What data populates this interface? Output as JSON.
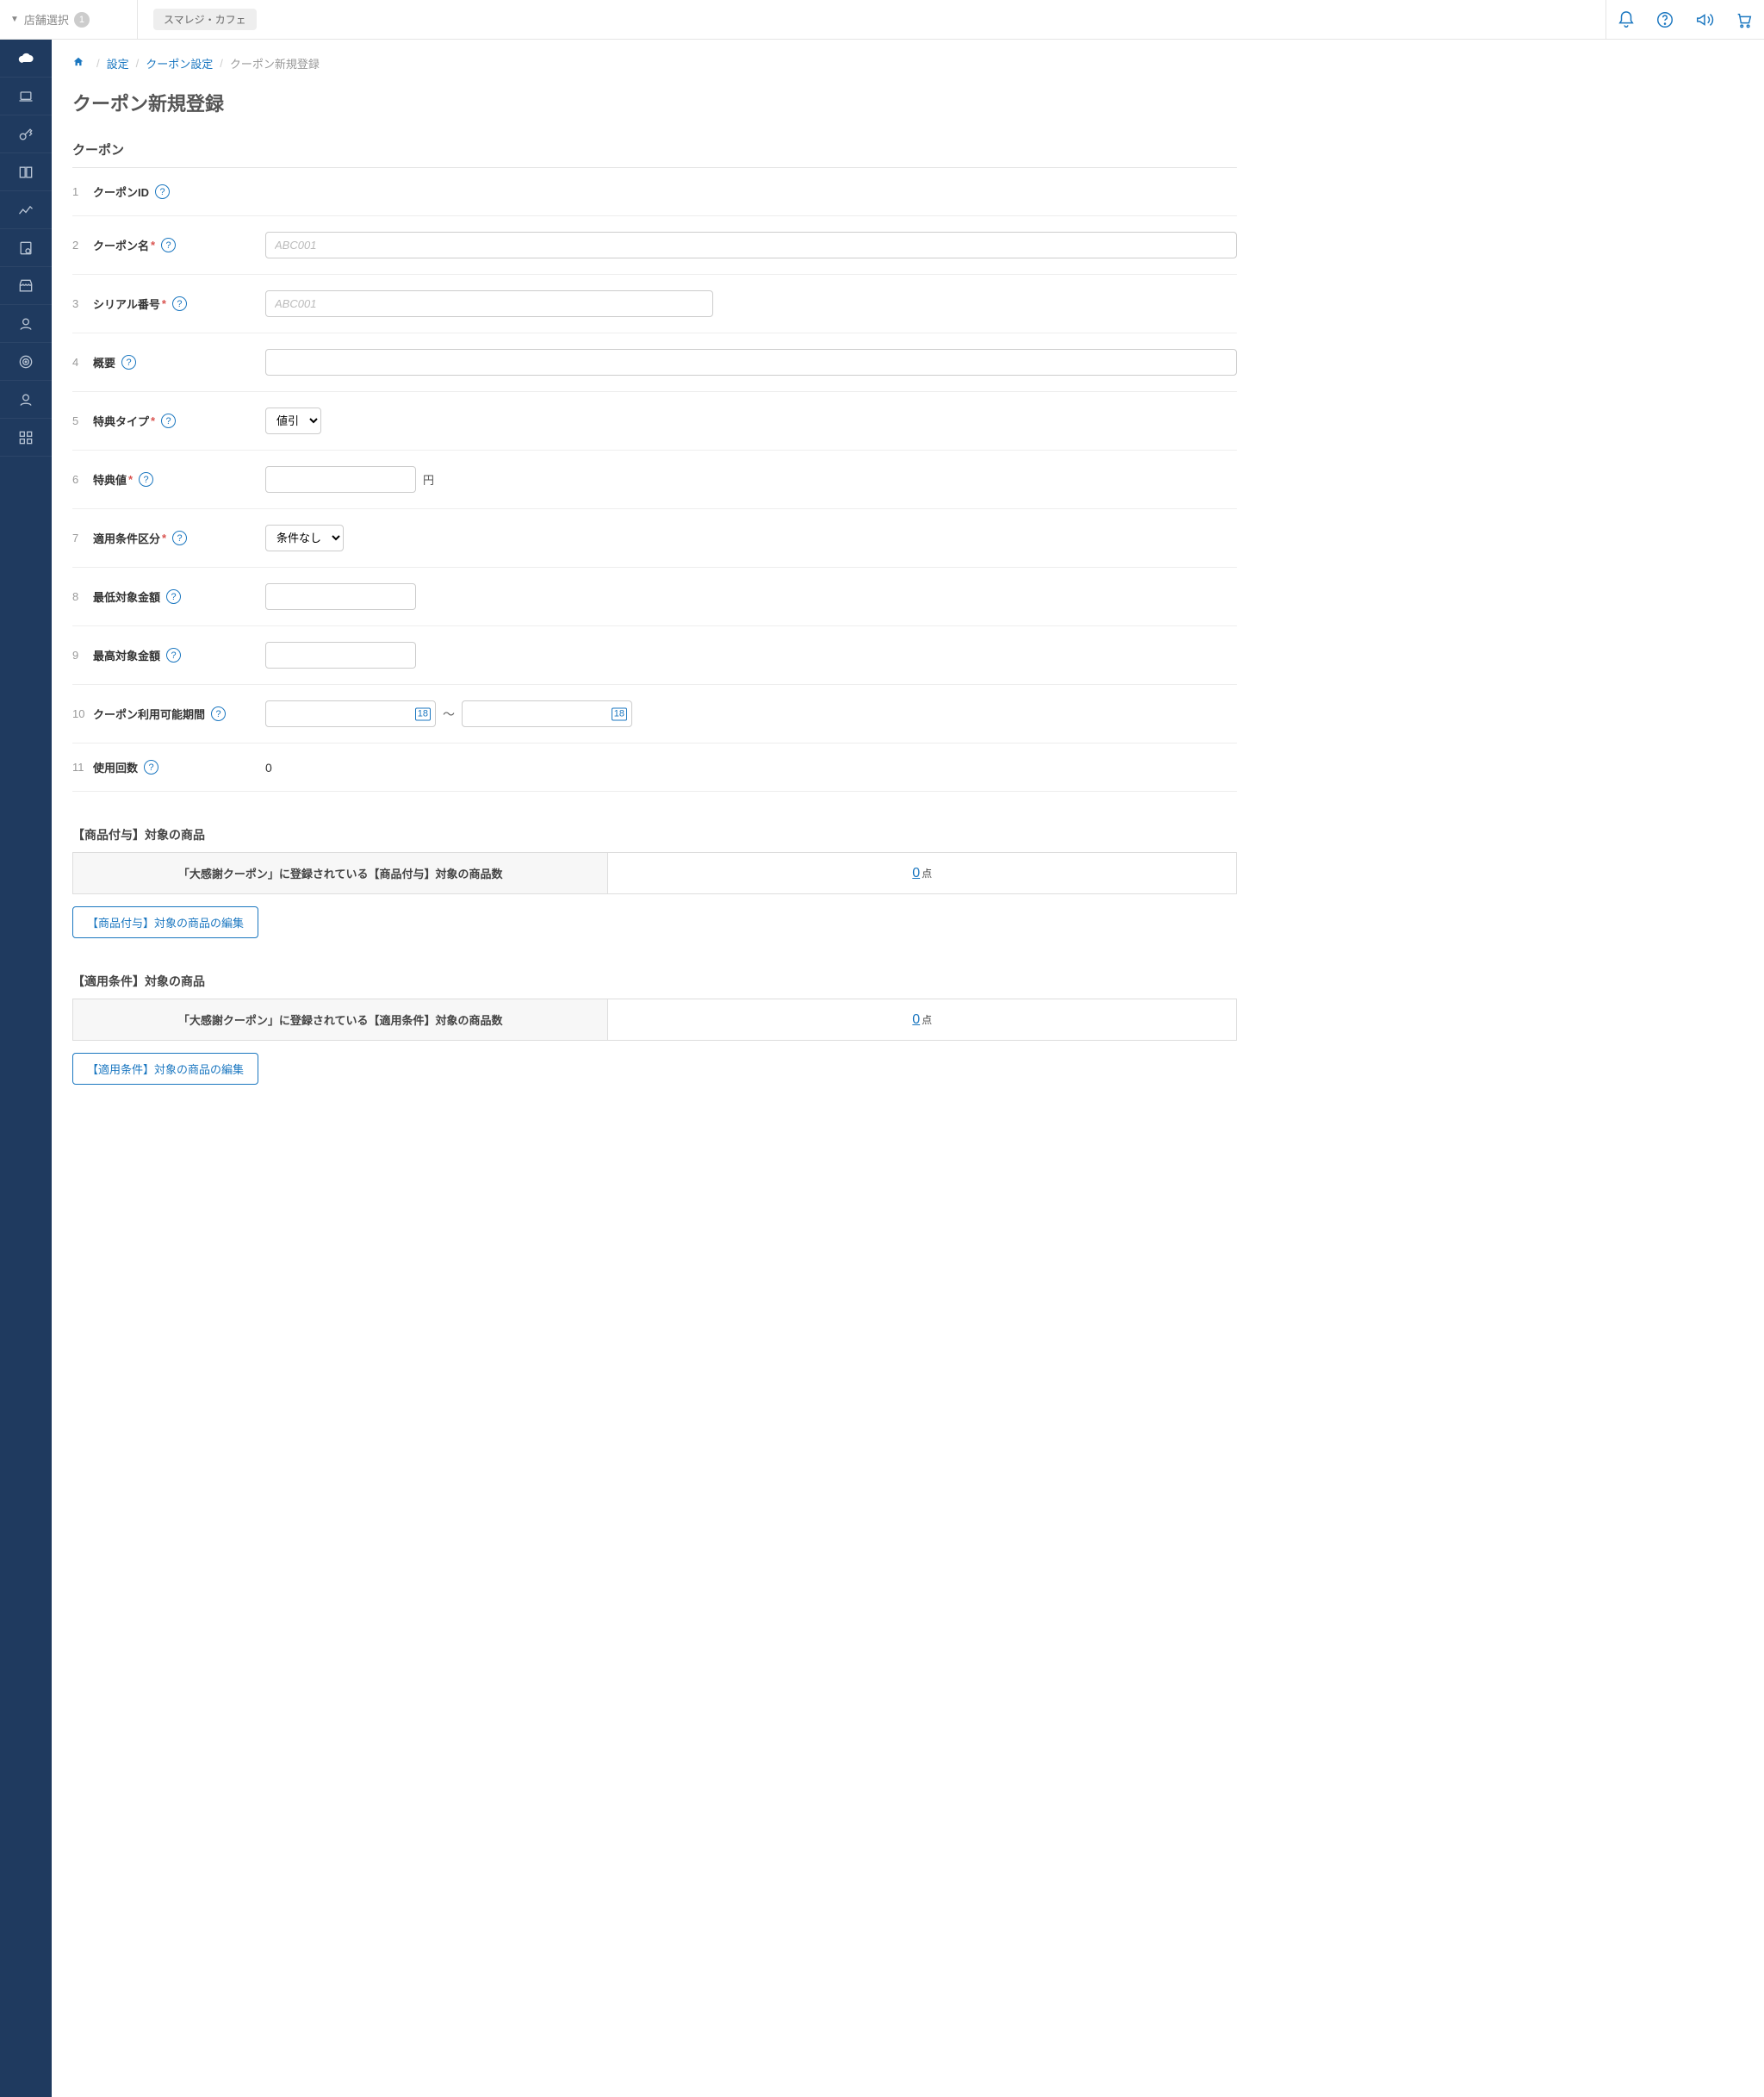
{
  "header": {
    "store_select_label": "店舗選択",
    "store_badge": "1",
    "store_name": "スマレジ・カフェ"
  },
  "breadcrumb": {
    "settings": "設定",
    "coupon_settings": "クーポン設定",
    "current": "クーポン新規登録"
  },
  "page_title": "クーポン新規登録",
  "coupon_section_title": "クーポン",
  "rows": {
    "1": {
      "num": "1",
      "label": "クーポンID"
    },
    "2": {
      "num": "2",
      "label": "クーポン名",
      "placeholder": "ABC001"
    },
    "3": {
      "num": "3",
      "label": "シリアル番号",
      "placeholder": "ABC001"
    },
    "4": {
      "num": "4",
      "label": "概要"
    },
    "5": {
      "num": "5",
      "label": "特典タイプ",
      "select": "値引"
    },
    "6": {
      "num": "6",
      "label": "特典値",
      "unit": "円"
    },
    "7": {
      "num": "7",
      "label": "適用条件区分",
      "select": "条件なし"
    },
    "8": {
      "num": "8",
      "label": "最低対象金額"
    },
    "9": {
      "num": "9",
      "label": "最高対象金額"
    },
    "10": {
      "num": "10",
      "label": "クーポン利用可能期間",
      "sep": "〜",
      "cal": "18"
    },
    "11": {
      "num": "11",
      "label": "使用回数",
      "value": "0"
    }
  },
  "product_grant": {
    "title": "【商品付与】対象の商品",
    "desc": "「大感謝クーポン」に登録されている【商品付与】対象の商品数",
    "count": "0",
    "unit": "点",
    "edit_button": "【商品付与】対象の商品の編集"
  },
  "apply_cond": {
    "title": "【適用条件】対象の商品",
    "desc": "「大感謝クーポン」に登録されている【適用条件】対象の商品数",
    "count": "0",
    "unit": "点",
    "edit_button": "【適用条件】対象の商品の編集"
  }
}
